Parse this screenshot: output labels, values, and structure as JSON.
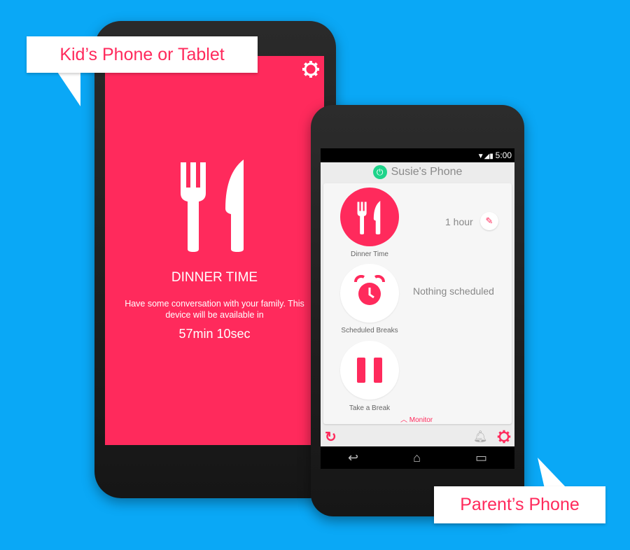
{
  "callouts": {
    "kid": "Kid’s Phone or Tablet",
    "parent": "Parent’s Phone"
  },
  "kid_screen": {
    "title": "DINNER TIME",
    "message": "Have some conversation with your family. This device will be available in",
    "countdown": "57min 10sec",
    "bg_color": "#ff2a5c"
  },
  "parent_screen": {
    "status_time": "5:00",
    "device_name": "Susie's Phone",
    "modes": [
      {
        "label": "Dinner Time",
        "value": "1 hour",
        "icon": "fork-knife-icon"
      },
      {
        "label": "Scheduled Breaks",
        "value": "Nothing scheduled",
        "icon": "alarm-clock-icon"
      },
      {
        "label": "Take a Break",
        "icon": "pause-icon"
      }
    ],
    "monitor_label": "Monitor",
    "accent": "#ff2a5c",
    "power_color": "#1ed48a"
  }
}
